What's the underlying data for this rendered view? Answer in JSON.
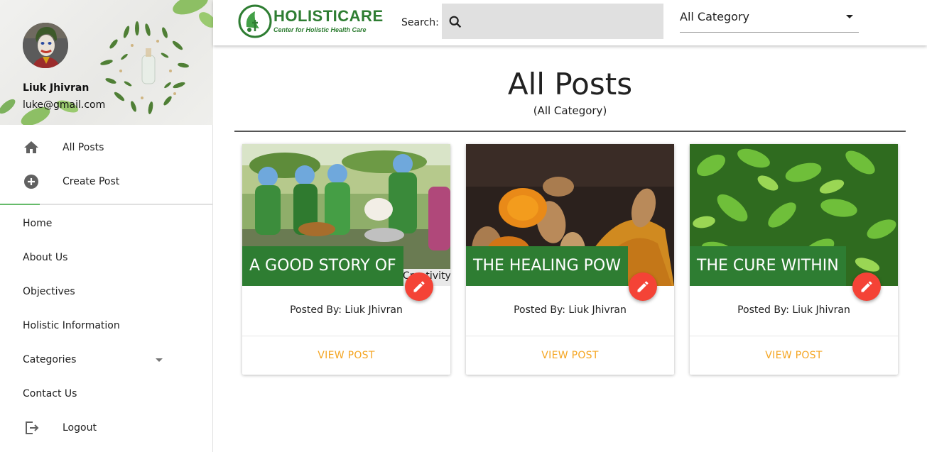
{
  "brand": {
    "title": "HOLISTICARE",
    "subtitle": "Center for Holistic Health Care",
    "color": "#2e7d32"
  },
  "user": {
    "name": "Liuk Jhivran",
    "email": "luke@gmail.com"
  },
  "sidebar": {
    "primary": [
      {
        "label": "All Posts",
        "icon": "home-icon"
      },
      {
        "label": "Create Post",
        "icon": "add-circle-icon"
      }
    ],
    "links": [
      {
        "label": "Home"
      },
      {
        "label": "About Us"
      },
      {
        "label": "Objectives"
      },
      {
        "label": "Holistic Information"
      },
      {
        "label": "Categories",
        "icon": "chevron-down-icon"
      },
      {
        "label": "Contact Us"
      },
      {
        "label": "Logout",
        "icon": "logout-icon"
      }
    ]
  },
  "header": {
    "search_label": "Search:",
    "search_placeholder": "",
    "category_selected": "All Category"
  },
  "main": {
    "title": "All Posts",
    "subtitle": "(All Category)"
  },
  "posts": [
    {
      "title": "A GOOD STORY OF",
      "image_overlay": "Creativity",
      "posted_by": "Posted By: Liuk Jhivran",
      "action": "VIEW POST"
    },
    {
      "title": "THE HEALING POW",
      "posted_by": "Posted By: Liuk Jhivran",
      "action": "VIEW POST"
    },
    {
      "title": "THE CURE WITHIN",
      "posted_by": "Posted By: Liuk Jhivran",
      "action": "VIEW POST"
    }
  ],
  "colors": {
    "accent_green": "#2e7d32",
    "edit_red": "#f44336",
    "view_link": "#f5a623",
    "active_indicator": "#66bb6a"
  }
}
